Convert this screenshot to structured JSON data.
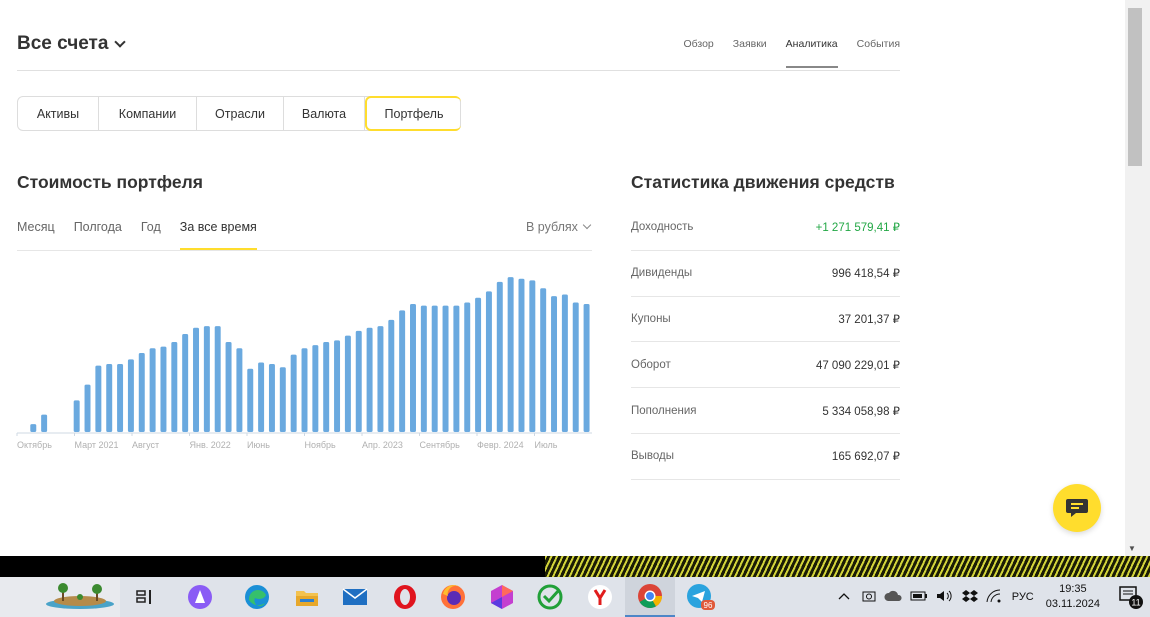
{
  "header": {
    "account_title": "Все счета",
    "nav": [
      "Обзор",
      "Заявки",
      "Аналитика",
      "События"
    ],
    "active_nav": "Аналитика"
  },
  "segments": [
    "Активы",
    "Компании",
    "Отрасли",
    "Валюта",
    "Портфель"
  ],
  "active_segment": "Портфель",
  "portfolio": {
    "title": "Стоимость портфеля",
    "periods": [
      "Месяц",
      "Полгода",
      "Год",
      "За все время"
    ],
    "active_period": "За все время",
    "currency": "В рублях"
  },
  "stats": {
    "title": "Статистика движения средств",
    "rows": [
      {
        "label": "Доходность",
        "value": "+1 271 579,41 ₽"
      },
      {
        "label": "Дивиденды",
        "value": "996 418,54 ₽"
      },
      {
        "label": "Купоны",
        "value": "37 201,37 ₽"
      },
      {
        "label": "Оборот",
        "value": "47 090 229,01 ₽"
      },
      {
        "label": "Пополнения",
        "value": "5 334 058,98 ₽"
      },
      {
        "label": "Выводы",
        "value": "165 692,07 ₽"
      }
    ]
  },
  "chart_data": {
    "type": "bar",
    "x_tick_labels": [
      "Октябрь",
      "Март 2021",
      "Август",
      "Янв. 2022",
      "Июнь",
      "Ноябрь",
      "Апр. 2023",
      "Сентябрь",
      "Февр. 2024",
      "Июль"
    ],
    "values": [
      0,
      5,
      11,
      0,
      0,
      20,
      30,
      42,
      43,
      43,
      46,
      50,
      53,
      54,
      57,
      62,
      66,
      67,
      67,
      57,
      53,
      40,
      44,
      43,
      41,
      49,
      53,
      55,
      57,
      58,
      61,
      64,
      66,
      67,
      71,
      77,
      81,
      80,
      80,
      80,
      80,
      82,
      85,
      89,
      95,
      98,
      97,
      96,
      91,
      86,
      87,
      82,
      81
    ],
    "ylim": [
      0,
      100
    ],
    "color": "#6aa9df"
  },
  "taskbar": {
    "apps": [
      "task-view",
      "alice",
      "edge",
      "explorer",
      "mail",
      "opera",
      "firefox",
      "app-hex",
      "sber",
      "yandex",
      "chrome",
      "telegram"
    ],
    "active_app": "chrome",
    "telegram_badge": "96",
    "language": "РУС",
    "time": "19:35",
    "date": "03.11.2024",
    "notification_count": "11"
  },
  "colors": {
    "accent": "#ffdd2d",
    "bar": "#6aa9df",
    "positive": "#22a745"
  }
}
